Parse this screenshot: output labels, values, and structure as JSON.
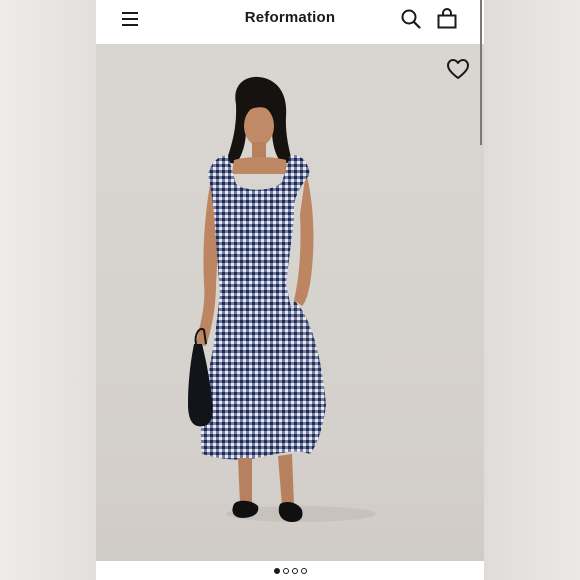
{
  "header": {
    "brand": "Reformation",
    "menu_icon": "hamburger-menu-icon",
    "search_icon": "search-icon",
    "bag_icon": "shopping-bag-icon"
  },
  "product_image": {
    "favorite_icon": "heart-outline-icon",
    "description_colors": {
      "dress_pattern": "#2f3d6b",
      "background": "#d7d3cf"
    }
  },
  "carousel": {
    "total_slides": 4,
    "active_index": 0
  }
}
